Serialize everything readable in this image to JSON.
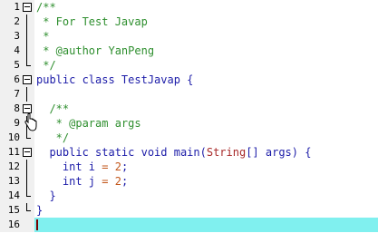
{
  "editor": {
    "lines": [
      {
        "num": "1",
        "fold": "box",
        "tokens": [
          {
            "t": "/**",
            "c": "comment"
          }
        ]
      },
      {
        "num": "2",
        "fold": "line",
        "tokens": [
          {
            "t": " * For Test Javap",
            "c": "comment"
          }
        ]
      },
      {
        "num": "3",
        "fold": "line",
        "tokens": [
          {
            "t": " *",
            "c": "comment"
          }
        ]
      },
      {
        "num": "4",
        "fold": "line",
        "tokens": [
          {
            "t": " * @author YanPeng",
            "c": "comment"
          }
        ]
      },
      {
        "num": "5",
        "fold": "end",
        "tokens": [
          {
            "t": " */",
            "c": "comment"
          }
        ]
      },
      {
        "num": "6",
        "fold": "box",
        "tokens": [
          {
            "t": "public class ",
            "c": "kw"
          },
          {
            "t": "TestJavap {",
            "c": "plain"
          }
        ]
      },
      {
        "num": "7",
        "fold": "line",
        "tokens": []
      },
      {
        "num": "8",
        "fold": "box",
        "tokens": [
          {
            "t": "  /**",
            "c": "comment"
          }
        ]
      },
      {
        "num": "9",
        "fold": "line",
        "tokens": [
          {
            "t": "   * @param args",
            "c": "comment"
          }
        ]
      },
      {
        "num": "10",
        "fold": "end",
        "tokens": [
          {
            "t": "   */",
            "c": "comment"
          }
        ]
      },
      {
        "num": "11",
        "fold": "box",
        "tokens": [
          {
            "t": "  public static void ",
            "c": "kw"
          },
          {
            "t": "main(",
            "c": "plain"
          },
          {
            "t": "String",
            "c": "type"
          },
          {
            "t": "[] args) {",
            "c": "plain"
          }
        ]
      },
      {
        "num": "12",
        "fold": "line",
        "tokens": [
          {
            "t": "    int ",
            "c": "kw"
          },
          {
            "t": "i ",
            "c": "plain"
          },
          {
            "t": "=",
            "c": "op"
          },
          {
            "t": " ",
            "c": "plain"
          },
          {
            "t": "2",
            "c": "num"
          },
          {
            "t": ";",
            "c": "plain"
          }
        ]
      },
      {
        "num": "13",
        "fold": "line",
        "tokens": [
          {
            "t": "    int ",
            "c": "kw"
          },
          {
            "t": "j ",
            "c": "plain"
          },
          {
            "t": "=",
            "c": "op"
          },
          {
            "t": " ",
            "c": "plain"
          },
          {
            "t": "2",
            "c": "num"
          },
          {
            "t": ";",
            "c": "plain"
          }
        ]
      },
      {
        "num": "14",
        "fold": "end",
        "tokens": [
          {
            "t": "  }",
            "c": "plain"
          }
        ]
      },
      {
        "num": "15",
        "fold": "end",
        "tokens": [
          {
            "t": "}",
            "c": "plain"
          }
        ]
      },
      {
        "num": "16",
        "fold": "none",
        "active": true,
        "tokens": []
      }
    ]
  },
  "icons": {
    "fold": "fold-collapse-icon",
    "cursor": "hand-pointer-icon"
  },
  "colors": {
    "active_line": "#80f0ef",
    "comment": "#2f8f2f",
    "keyword": "#1c1ca8",
    "type": "#a82a2a",
    "number": "#c2561a"
  }
}
